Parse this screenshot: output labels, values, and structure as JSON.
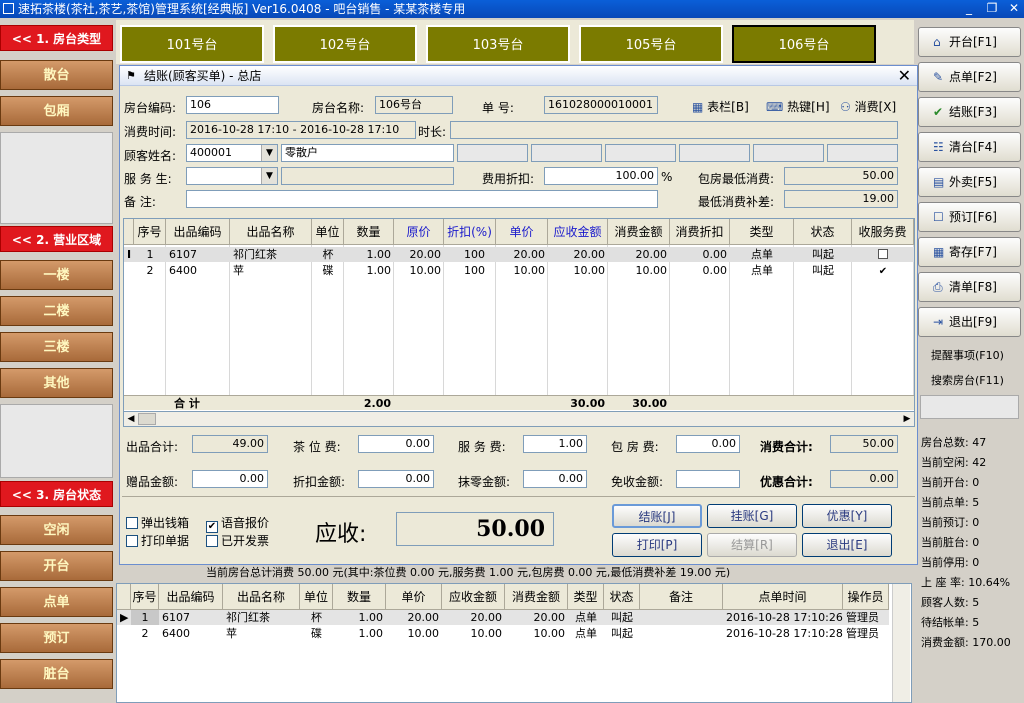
{
  "app_title": "速拓茶楼(茶社,茶艺,茶馆)管理系统[经典版]  Ver16.0408  -  吧台销售  -  某某茶楼专用",
  "window_controls": {
    "minimize": "_",
    "restore": "❐",
    "close": "✕"
  },
  "left_panel": {
    "sections": [
      {
        "header": "<< 1. 房台类型 >>",
        "items": [
          "散台",
          "包厢"
        ]
      },
      {
        "header": "<< 2. 营业区域 >>",
        "items": [
          "一楼",
          "二楼",
          "三楼",
          "其他"
        ]
      },
      {
        "header": "<< 3. 房台状态 >>",
        "items": [
          "空闲",
          "开台",
          "点单",
          "预订",
          "脏台"
        ]
      }
    ]
  },
  "tables": [
    {
      "name": "101号台",
      "selected": false
    },
    {
      "name": "102号台",
      "selected": false
    },
    {
      "name": "103号台",
      "selected": false
    },
    {
      "name": "105号台",
      "selected": false
    },
    {
      "name": "106号台",
      "selected": true
    }
  ],
  "right_panel": {
    "buttons": [
      {
        "label": "开台[F1]",
        "icon": "open-table-icon"
      },
      {
        "label": "点单[F2]",
        "icon": "order-icon"
      },
      {
        "label": "结账[F3]",
        "icon": "checkout-icon"
      },
      {
        "label": "清台[F4]",
        "icon": "clear-table-icon"
      },
      {
        "label": "外卖[F5]",
        "icon": "takeout-icon"
      },
      {
        "label": "预订[F6]",
        "icon": "reservation-icon"
      },
      {
        "label": "寄存[F7]",
        "icon": "storage-icon"
      },
      {
        "label": "清单[F8]",
        "icon": "printer-icon"
      },
      {
        "label": "退出[F9]",
        "icon": "exit-icon"
      }
    ],
    "links": [
      "提醒事项(F10)",
      "搜索房台(F11)"
    ],
    "stats": [
      "房台总数: 47",
      "当前空闲: 42",
      "当前开台: 0",
      "当前点单: 5",
      "当前预订: 0",
      "当前脏台: 0",
      "当前停用: 0",
      "上 座 率: 10.64%",
      "顾客人数: 5",
      "待结帐单: 5",
      "消费金额: 170.00"
    ]
  },
  "dialog": {
    "title": "结账(顾客买单) - 总店",
    "room_code_label": "房台编码:",
    "room_code": "106",
    "room_name_label": "房台名称:",
    "room_name": "106号台",
    "order_no_label": "单    号:",
    "order_no": "161028000010001",
    "toolbar": [
      "表栏[B]",
      "热键[H]",
      "消费[X]"
    ],
    "consume_time_label": "消费时间:",
    "consume_time": "2016-10-28 17:10 - 2016-10-28 17:10",
    "duration_label": "时长:",
    "customer_label": "顾客姓名:",
    "customer_code": "400001",
    "customer_name": "零散户",
    "waiter_label": "服 务 生:",
    "discount_label": "费用折扣:",
    "discount": "100.00",
    "percent": "%",
    "min_consume_label": "包房最低消费:",
    "min_consume": "50.00",
    "remark_label": "备    注:",
    "min_subsidy_label": "最低消费补差:",
    "min_subsidy": "19.00",
    "grid_headers": [
      "序号",
      "出品编码",
      "出品名称",
      "单位",
      "数量",
      "原价",
      "折扣(%)",
      "单价",
      "应收金额",
      "消费金额",
      "消费折扣",
      "类型",
      "状态",
      "收服务费"
    ],
    "rows": [
      {
        "seq": "1",
        "code": "6107",
        "name": "祁门红茶",
        "unit": "杯",
        "qty": "1.00",
        "orig": "20.00",
        "disc": "100",
        "price": "20.00",
        "due": "20.00",
        "amount": "20.00",
        "cdisc": "0.00",
        "type": "点单",
        "status": "叫起",
        "svc": false
      },
      {
        "seq": "2",
        "code": "6400",
        "name": "苹",
        "unit": "碟",
        "qty": "1.00",
        "orig": "10.00",
        "disc": "100",
        "price": "10.00",
        "due": "10.00",
        "amount": "10.00",
        "cdisc": "0.00",
        "type": "点单",
        "status": "叫起",
        "svc": true
      }
    ],
    "total_label": "合  计",
    "total_qty": "2.00",
    "total_due": "30.00",
    "total_amount": "30.00",
    "summary": {
      "items_total_label": "出品合计:",
      "items_total": "49.00",
      "tea_fee_label": "茶 位 费:",
      "tea_fee": "0.00",
      "service_fee_label": "服 务 费:",
      "service_fee": "1.00",
      "room_fee_label": "包 房 费:",
      "room_fee": "0.00",
      "consume_total_label": "消费合计:",
      "consume_total": "50.00",
      "gift_label": "赠品金额:",
      "gift": "0.00",
      "discount_amt_label": "折扣金额:",
      "discount_amt": "0.00",
      "round_label": "抹零金额:",
      "round": "0.00",
      "free_label": "免收金额:",
      "free": "",
      "offer_total_label": "优惠合计:",
      "offer_total": "0.00"
    },
    "checks": [
      {
        "label": "弹出钱箱",
        "checked": false
      },
      {
        "label": "语音报价",
        "checked": true
      },
      {
        "label": "打印单据",
        "checked": false
      },
      {
        "label": "已开发票",
        "checked": false
      }
    ],
    "receivable_label": "应收:",
    "receivable": "50.00",
    "buttons": [
      "结账[J]",
      "挂账[G]",
      "优惠[Y]",
      "打印[P]",
      "结算[R]",
      "退出[E]"
    ]
  },
  "summary_line": "当前房台总计消费 50.00 元(其中:茶位费 0.00 元,服务费 1.00 元,包房费 0.00 元,最低消费补差 19.00 元)",
  "bottom_grid": {
    "headers": [
      "序号",
      "出品编码",
      "出品名称",
      "单位",
      "数量",
      "单价",
      "应收金额",
      "消费金额",
      "类型",
      "状态",
      "备注",
      "点单时间",
      "操作员"
    ],
    "rows": [
      {
        "seq": "1",
        "code": "6107",
        "name": "祁门红茶",
        "unit": "杯",
        "qty": "1.00",
        "price": "20.00",
        "due": "20.00",
        "amount": "20.00",
        "type": "点单",
        "status": "叫起",
        "note": "",
        "time": "2016-10-28 17:10:26",
        "op": "管理员"
      },
      {
        "seq": "2",
        "code": "6400",
        "name": "苹",
        "unit": "碟",
        "qty": "1.00",
        "price": "10.00",
        "due": "10.00",
        "amount": "10.00",
        "type": "点单",
        "status": "叫起",
        "note": "",
        "time": "2016-10-28 17:10:28",
        "op": "管理员"
      }
    ]
  }
}
